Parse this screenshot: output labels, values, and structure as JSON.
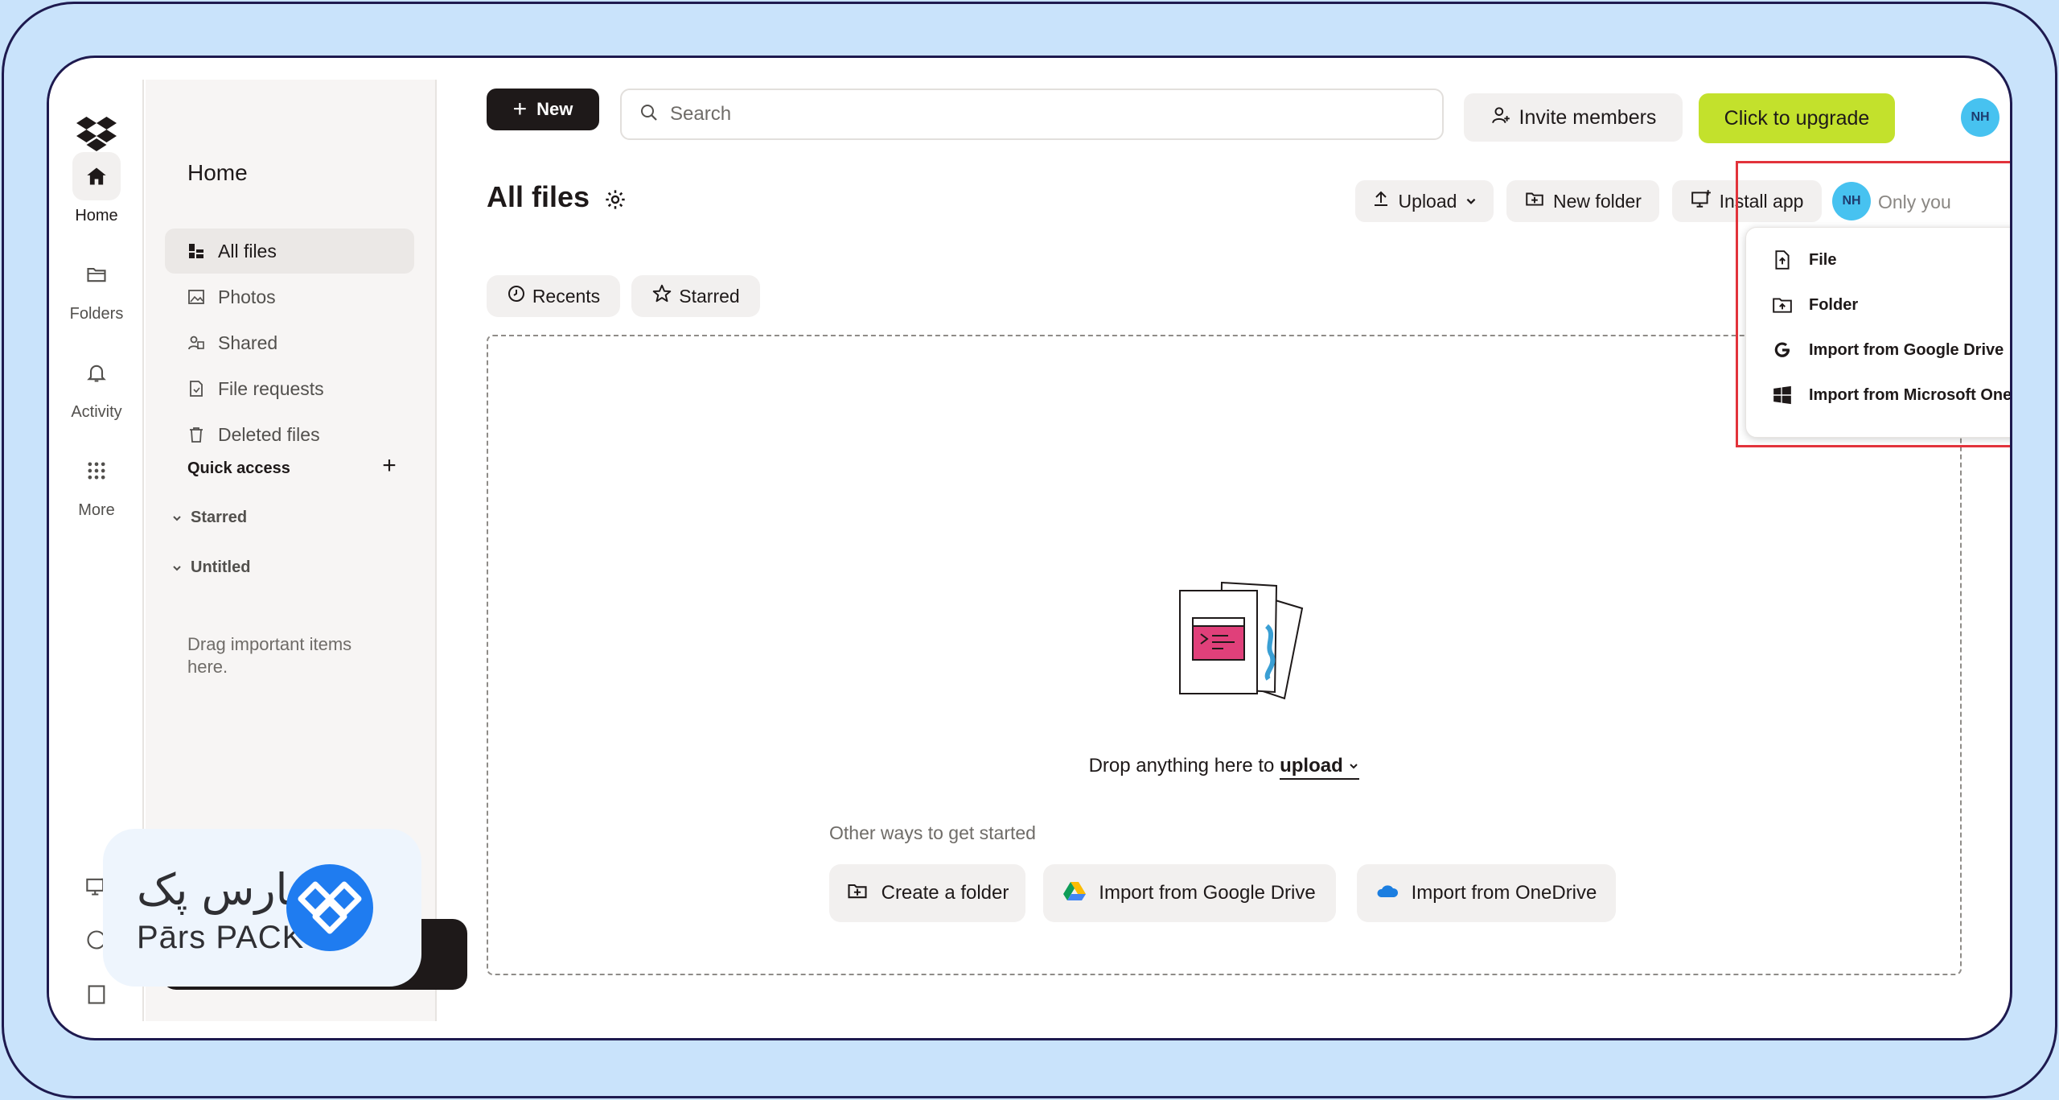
{
  "rail": {
    "items": [
      {
        "label": "Home",
        "icon": "home-icon"
      },
      {
        "label": "Folders",
        "icon": "folder-icon"
      },
      {
        "label": "Activity",
        "icon": "bell-icon"
      },
      {
        "label": "More",
        "icon": "grid-dots-icon"
      }
    ]
  },
  "sidebar": {
    "title": "Home",
    "items": [
      {
        "label": "All files",
        "icon": "all-files-icon"
      },
      {
        "label": "Photos",
        "icon": "photo-icon"
      },
      {
        "label": "Shared",
        "icon": "shared-icon"
      },
      {
        "label": "File requests",
        "icon": "file-request-icon"
      },
      {
        "label": "Deleted files",
        "icon": "trash-icon"
      }
    ],
    "quick_access": {
      "heading": "Quick access",
      "sections": [
        "Starred",
        "Untitled"
      ],
      "drag_hint": "Drag important items here."
    }
  },
  "badge": {
    "fa_text": "پارس پک",
    "en_text": "Pārs PACK"
  },
  "header": {
    "new_label": "New",
    "search_placeholder": "Search",
    "invite_label": "Invite members",
    "upgrade_label": "Click to upgrade",
    "avatar_initials": "NH"
  },
  "page": {
    "title": "All files",
    "toolbar": {
      "upload_label": "Upload",
      "new_folder_label": "New folder",
      "install_app_label": "Install app",
      "share_avatar": "NH",
      "share_status": "Only you"
    },
    "filters": [
      {
        "label": "Recents",
        "icon": "clock-icon"
      },
      {
        "label": "Starred",
        "icon": "star-icon"
      }
    ]
  },
  "upload_menu": {
    "items": [
      {
        "label": "File",
        "icon": "file-upload-icon"
      },
      {
        "label": "Folder",
        "icon": "folder-upload-icon"
      },
      {
        "label": "Import from Google Drive",
        "icon": "google-icon"
      },
      {
        "label": "Import from Microsoft OneDrive",
        "icon": "windows-icon"
      }
    ]
  },
  "dropzone": {
    "text_prefix": "Drop anything here to",
    "text_link": "upload",
    "other_ways": "Other ways to get started",
    "actions": [
      {
        "label": "Create a folder",
        "icon": "create-folder-icon"
      },
      {
        "label": "Import from Google Drive",
        "icon": "google-drive-icon"
      },
      {
        "label": "Import from OneDrive",
        "icon": "onedrive-icon"
      }
    ]
  },
  "colors": {
    "background": "#c9e3fb",
    "frame_border": "#1e1a4f",
    "upgrade_accent": "#c3e12c",
    "avatar": "#47c2f0",
    "highlight_box": "#e2333b",
    "badge_blue": "#1f7cf0"
  }
}
